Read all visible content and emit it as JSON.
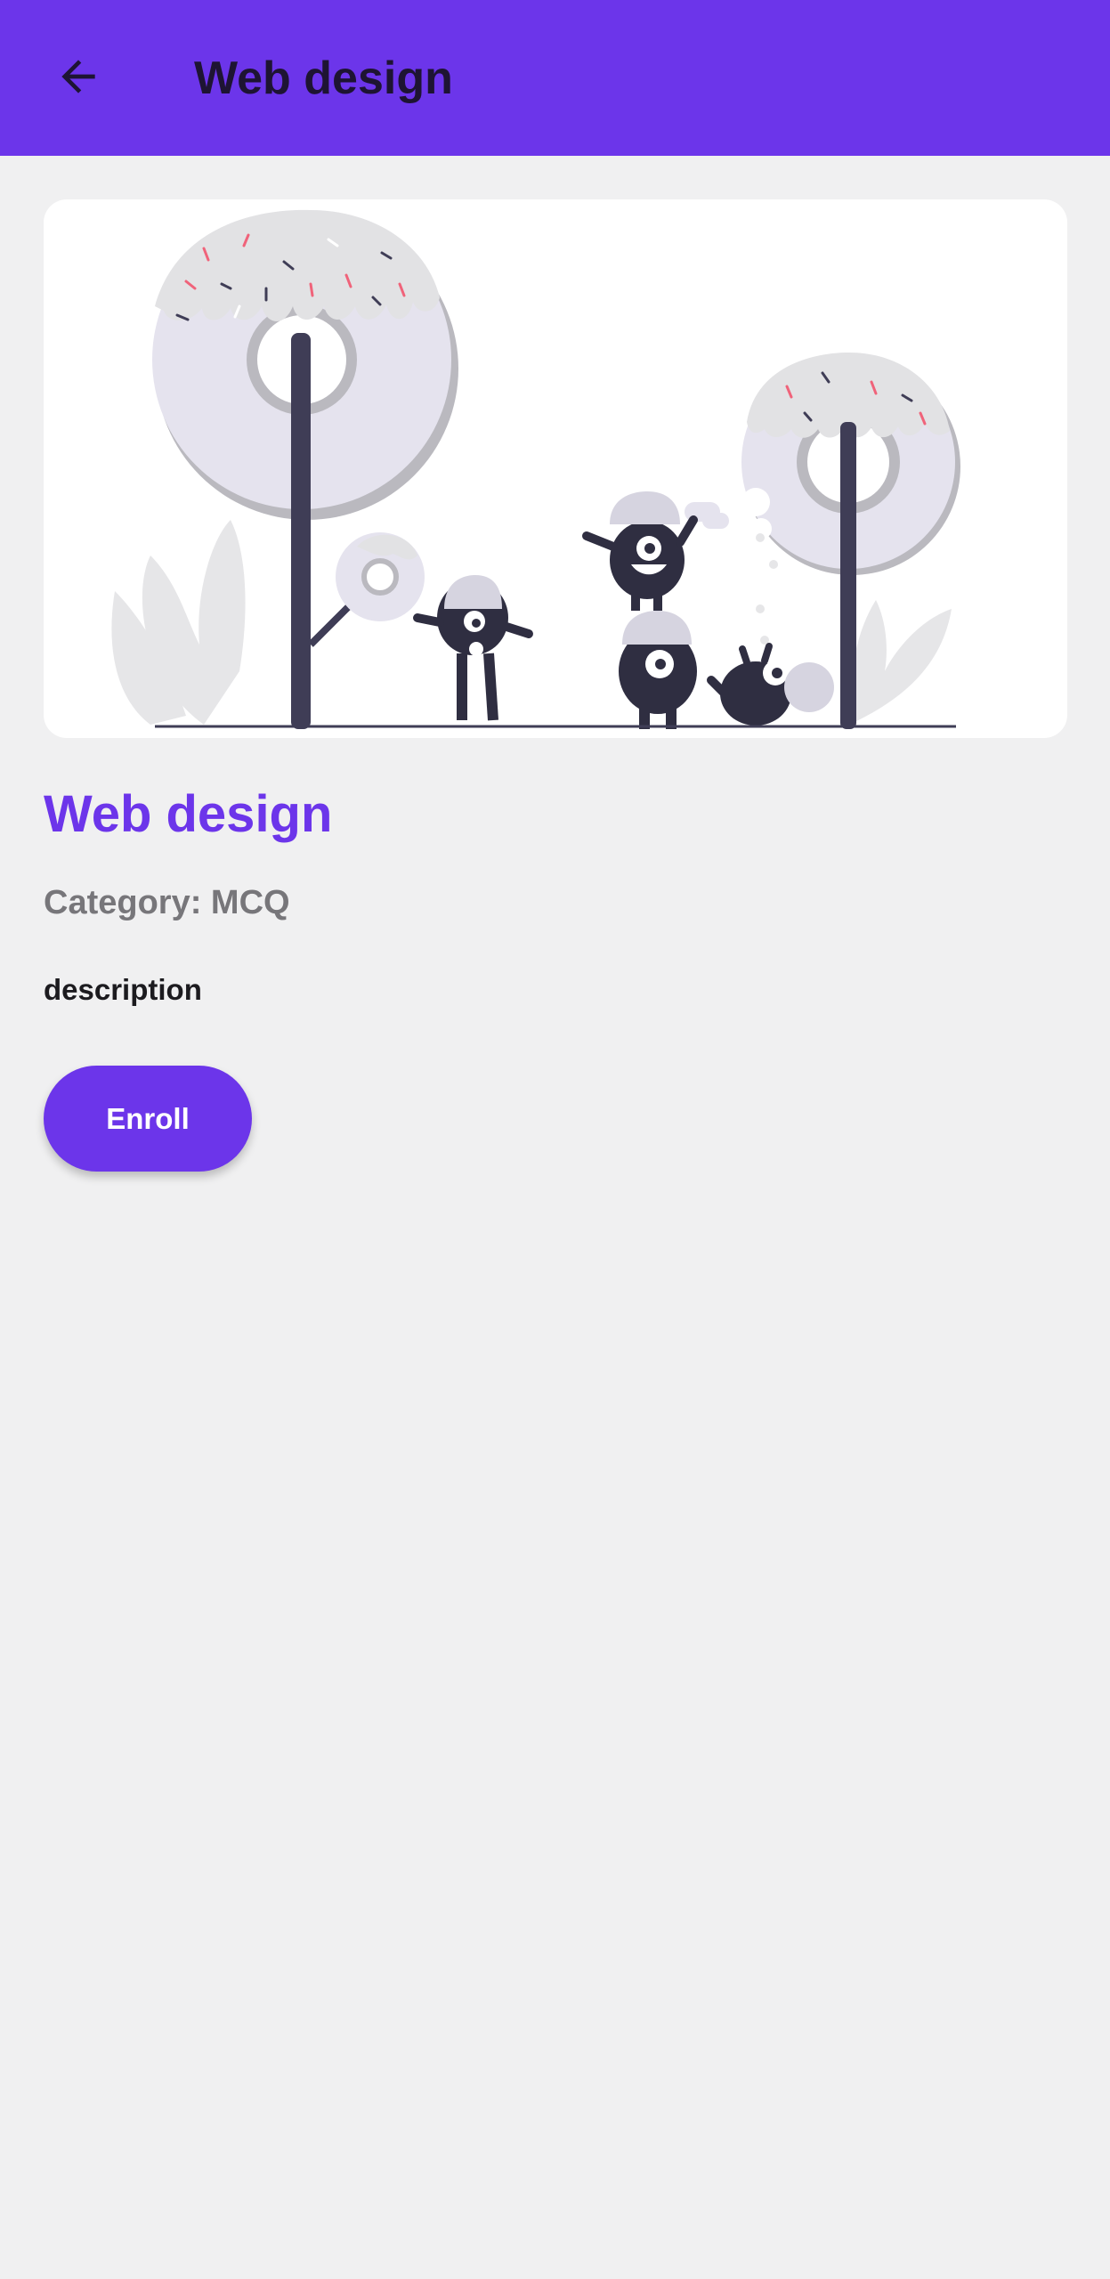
{
  "appbar": {
    "title": "Web design",
    "back_icon": "arrow-back-icon",
    "color": "#6c35ea"
  },
  "hero": {
    "illustration": "donut-trees-monsters-illustration"
  },
  "course": {
    "title": "Web design",
    "category": "Category: MCQ",
    "description": "description"
  },
  "actions": {
    "enroll_label": "Enroll"
  },
  "colors": {
    "primary": "#6c35ea",
    "background": "#f0f0f1",
    "title_text": "#1e1433",
    "muted_text": "#77767a"
  }
}
